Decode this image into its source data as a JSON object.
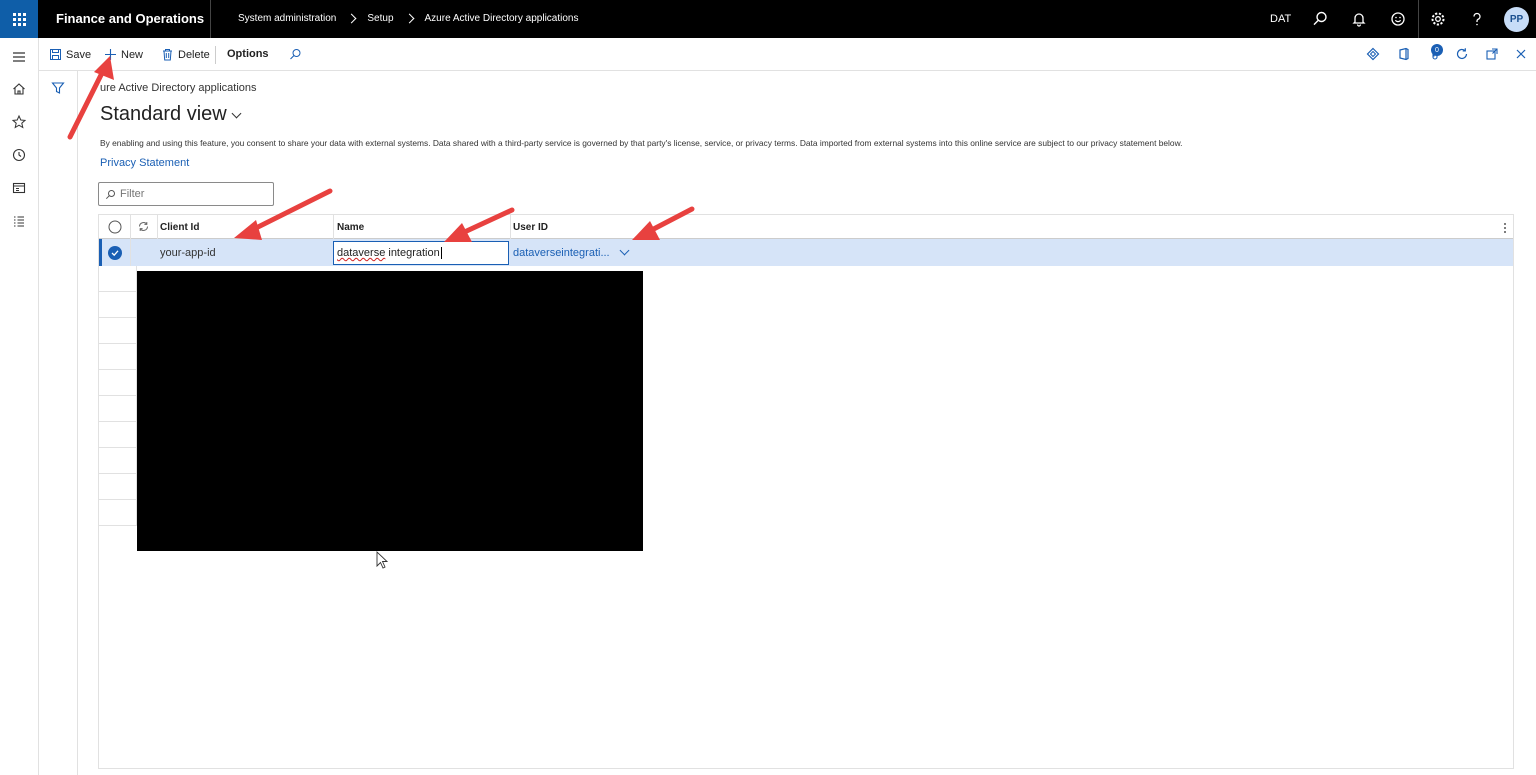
{
  "topbar": {
    "app_title": "Finance and Operations",
    "breadcrumbs": [
      "System administration",
      "Setup",
      "Azure Active Directory applications"
    ],
    "company": "DAT",
    "avatar_initials": "PP"
  },
  "actions": {
    "save": "Save",
    "new": "New",
    "delete": "Delete",
    "options": "Options",
    "notification_count": "0"
  },
  "page": {
    "breadcrumb": "ure Active Directory applications",
    "view_title": "Standard view",
    "consent_text": "By enabling and using this feature, you consent to share your data with external systems. Data shared with a third-party service is governed by that party's license, service, or privacy terms. Data imported from external systems into this online service are subject to our privacy statement below.",
    "privacy_link": "Privacy Statement",
    "filter_placeholder": "Filter"
  },
  "grid": {
    "columns": [
      "Client Id",
      "Name",
      "User ID"
    ],
    "selected_row": {
      "client_id": "your-app-id",
      "name_underlined": "dataverse",
      "name_rest": " integration",
      "user_id": "dataverseintegrati..."
    }
  },
  "colors": {
    "accent": "#1a5fb4",
    "topbar": "#000000",
    "selected_row": "#d6e4f8",
    "arrow": "#e8413f"
  }
}
